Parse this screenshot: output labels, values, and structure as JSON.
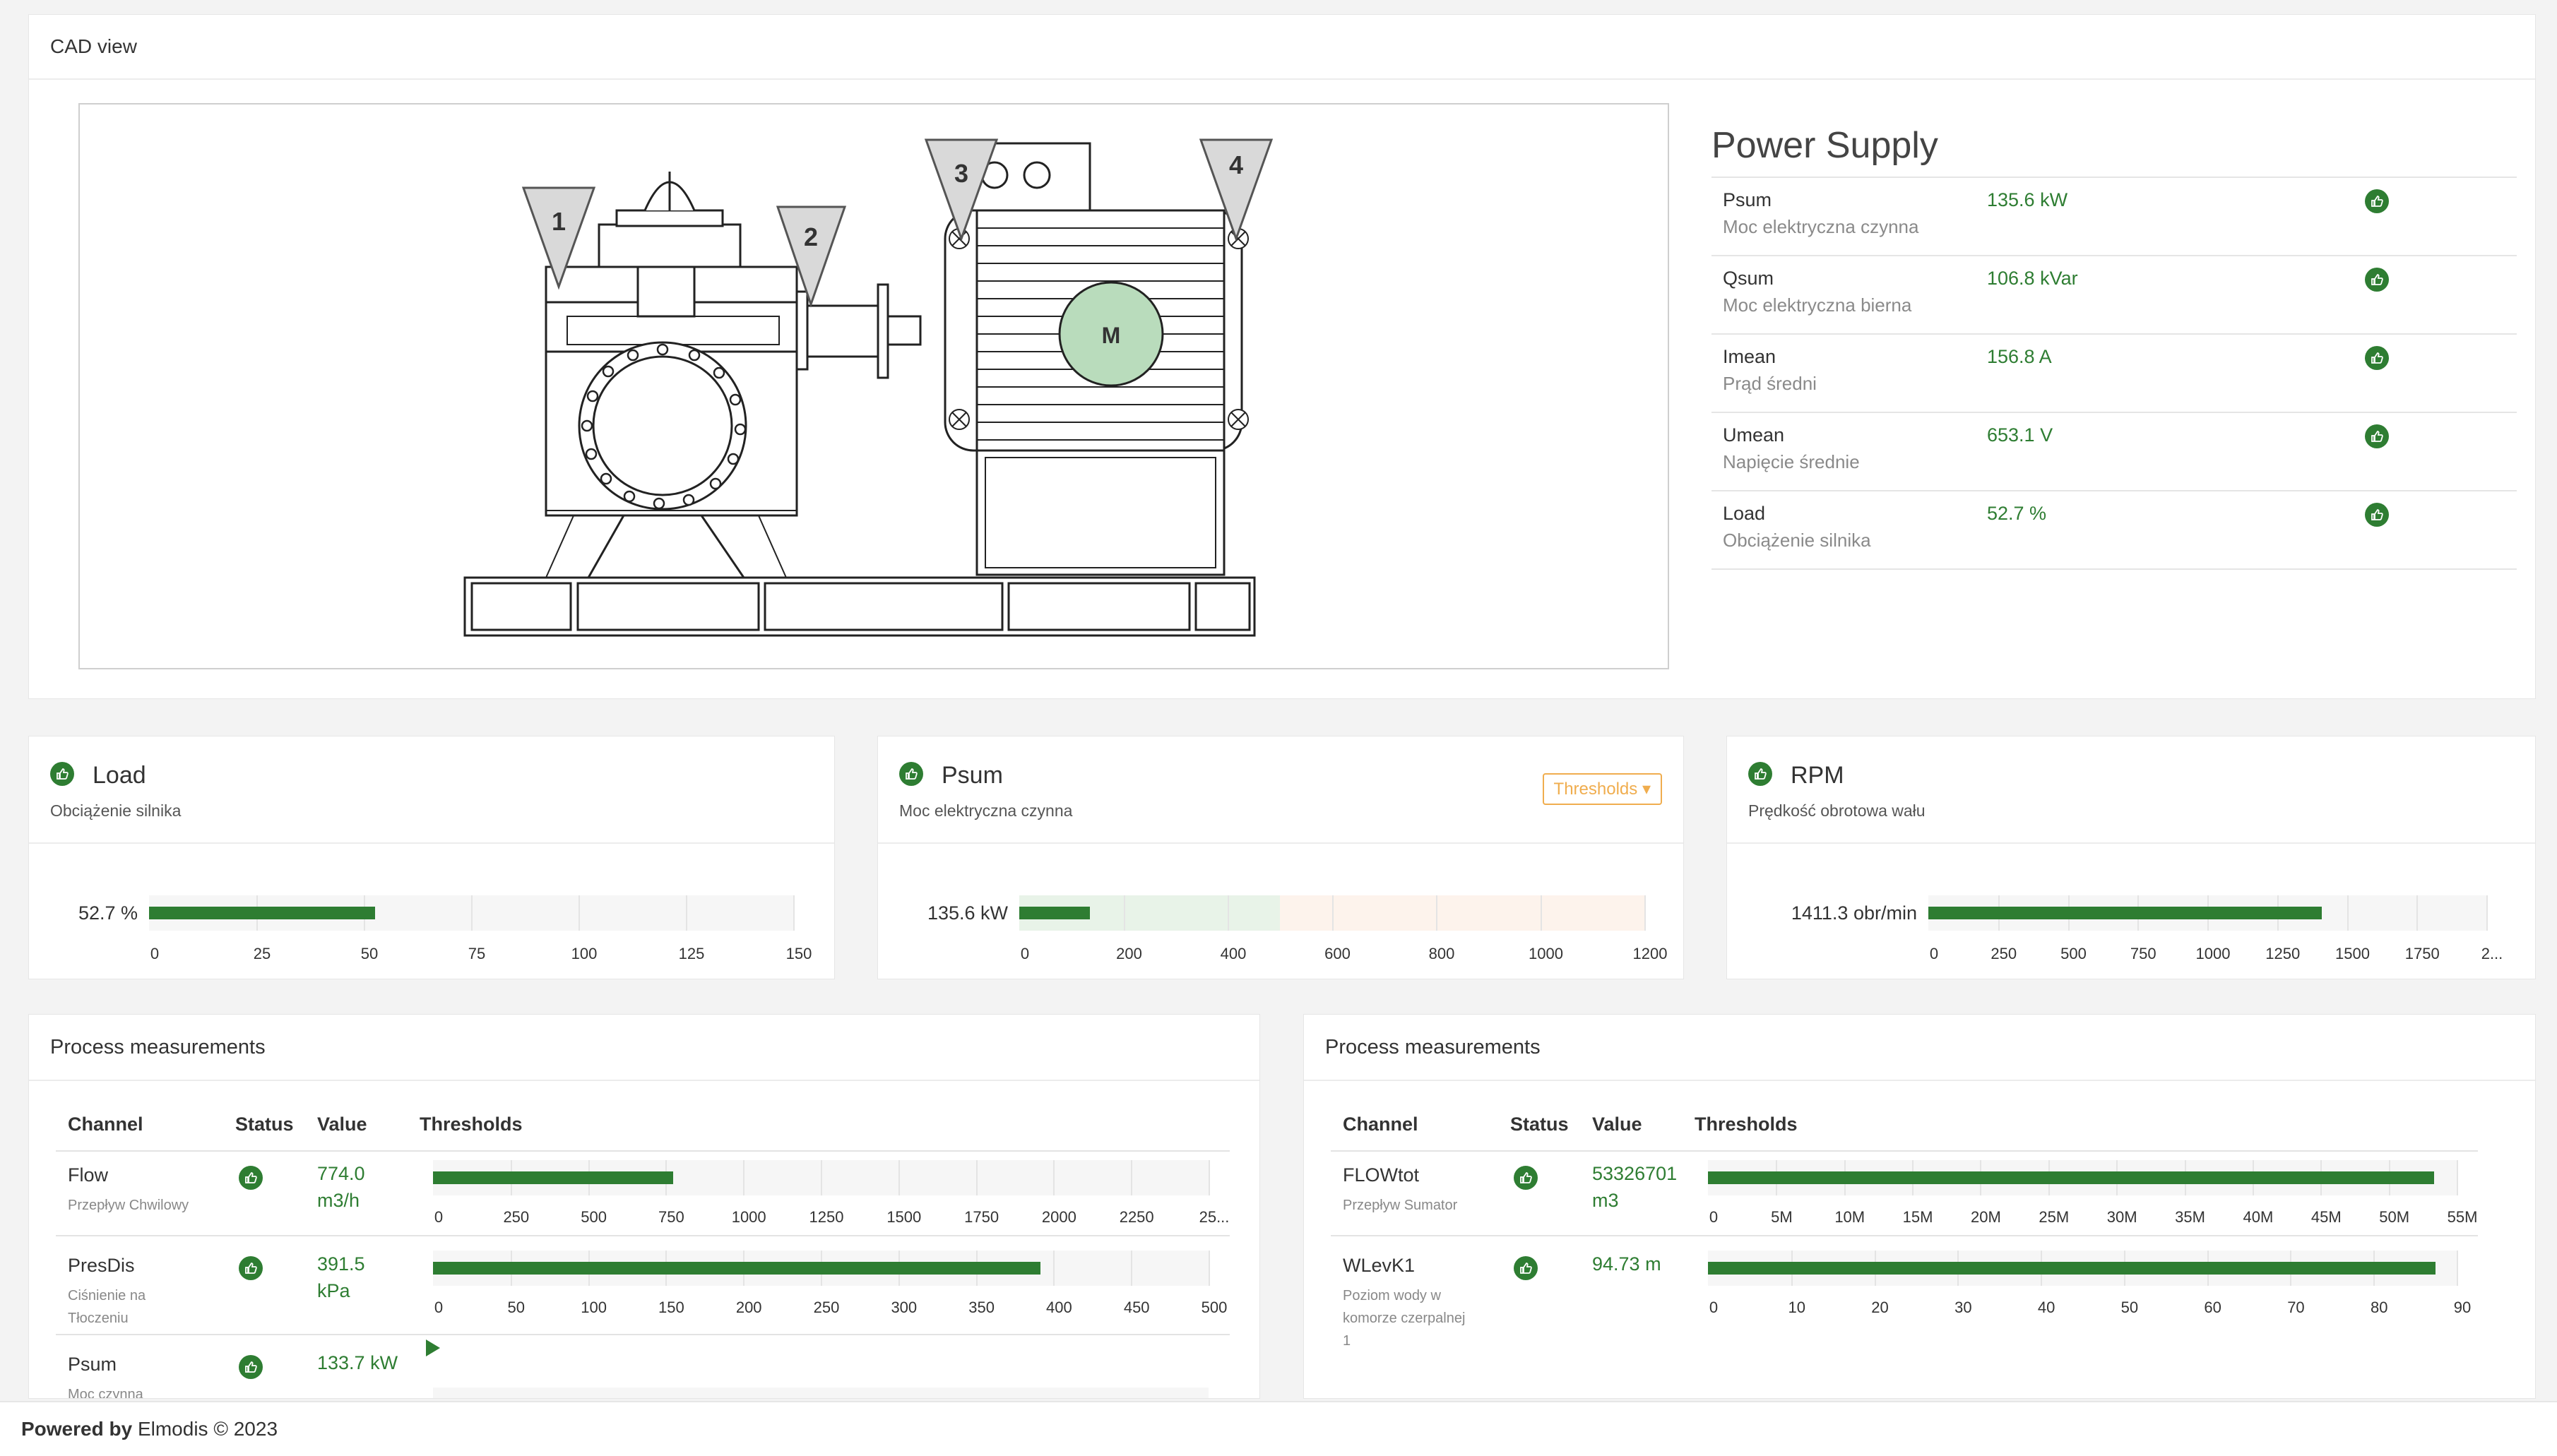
{
  "cad": {
    "title": "CAD view",
    "markers": [
      "1",
      "2",
      "3",
      "4"
    ],
    "motor_label": "M"
  },
  "power_supply": {
    "title": "Power Supply",
    "rows": [
      {
        "name": "Psum",
        "desc": "Moc elektryczna czynna",
        "value": "135.6 kW",
        "status_icon": "thumbs-up-icon"
      },
      {
        "name": "Qsum",
        "desc": "Moc elektryczna bierna",
        "value": "106.8 kVar",
        "status_icon": "thumbs-up-icon"
      },
      {
        "name": "Imean",
        "desc": "Prąd średni",
        "value": "156.8 A",
        "status_icon": "thumbs-up-icon"
      },
      {
        "name": "Umean",
        "desc": "Napięcie średnie",
        "value": "653.1 V",
        "status_icon": "thumbs-up-icon"
      },
      {
        "name": "Load",
        "desc": "Obciążenie silnika",
        "value": "52.7 %",
        "status_icon": "thumbs-up-icon"
      }
    ]
  },
  "gauges": {
    "load": {
      "title": "Load",
      "subtitle": "Obciążenie silnika",
      "value_text": "52.7 %",
      "value": 52.7,
      "min": 0,
      "max": 150,
      "ticks": [
        "0",
        "25",
        "50",
        "75",
        "100",
        "125",
        "150"
      ]
    },
    "psum": {
      "title": "Psum",
      "subtitle": "Moc elektryczna czynna",
      "value_text": "135.6 kW",
      "thresholds_label": "Thresholds",
      "value": 135.6,
      "min": 0,
      "max": 1200,
      "ticks": [
        "0",
        "200",
        "400",
        "600",
        "800",
        "1000",
        "1200"
      ],
      "zones": [
        {
          "from": 0,
          "to": 500,
          "color": "#e8f3e8"
        },
        {
          "from": 500,
          "to": 1200,
          "color": "#fdf3ec"
        }
      ]
    },
    "rpm": {
      "title": "RPM",
      "subtitle": "Prędkość obrotowa wału",
      "value_text": "1411.3 obr/min",
      "value": 1411.3,
      "min": 0,
      "max": 2000,
      "ticks": [
        "0",
        "250",
        "500",
        "750",
        "1000",
        "1250",
        "1500",
        "1750",
        "2..."
      ]
    }
  },
  "process_left": {
    "title": "Process measurements",
    "headers": {
      "channel": "Channel",
      "status": "Status",
      "value": "Value",
      "thresholds": "Thresholds"
    },
    "rows": [
      {
        "name": "Flow",
        "desc": "Przepływ Chwilowy",
        "value_line1": "774.0",
        "value_line2": "m3/h",
        "value": 774.0,
        "max": 2500,
        "ticks": [
          "0",
          "250",
          "500",
          "750",
          "1000",
          "1250",
          "1500",
          "1750",
          "2000",
          "2250",
          "25..."
        ]
      },
      {
        "name": "PresDis",
        "desc1": "Ciśnienie na",
        "desc2": "Tłoczeniu",
        "value_line1": "391.5",
        "value_line2": "kPa",
        "value": 391.5,
        "max": 500,
        "ticks": [
          "0",
          "50",
          "100",
          "150",
          "200",
          "250",
          "300",
          "350",
          "400",
          "450",
          "500"
        ]
      },
      {
        "name": "Psum",
        "desc": "Moc czynna",
        "value_line1": "133.7 kW",
        "value_line2": "",
        "value": 133.7,
        "max": 133.7
      }
    ]
  },
  "process_right": {
    "title": "Process measurements",
    "headers": {
      "channel": "Channel",
      "status": "Status",
      "value": "Value",
      "thresholds": "Thresholds"
    },
    "rows": [
      {
        "name": "FLOWtot",
        "desc": "Przepływ Sumator",
        "value_line1": "53326701",
        "value_line2": "m3",
        "value": 53326701,
        "max": 55000000,
        "ticks": [
          "0",
          "5M",
          "10M",
          "15M",
          "20M",
          "25M",
          "30M",
          "35M",
          "40M",
          "45M",
          "50M",
          "55M"
        ]
      },
      {
        "name": "WLevK1",
        "desc1": "Poziom wody w",
        "desc2": "komorze czerpalnej",
        "desc3": "1",
        "value_line1": "94.73 m",
        "value_line2": "",
        "value": 94.73,
        "max": 97.5,
        "ticks": [
          "0",
          "10",
          "20",
          "30",
          "40",
          "50",
          "60",
          "70",
          "80",
          "90"
        ]
      }
    ]
  },
  "footer": {
    "powered_by": "Powered by",
    "brand": "Elmodis © 2023"
  },
  "colors": {
    "accent_green": "#2e7d32",
    "threshold_orange": "#f0ad4e",
    "motor_fill": "#b9dcbc"
  }
}
